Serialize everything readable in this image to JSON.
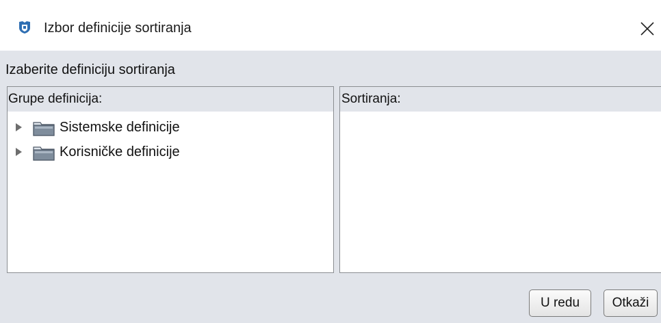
{
  "window": {
    "title": "Izbor definicije sortiranja",
    "app_icon": "app-shield-icon",
    "close_icon": "close-icon"
  },
  "instruction": "Izaberite definiciju sortiranja",
  "groups_panel": {
    "header": "Grupe definicija:",
    "items": [
      {
        "label": "Sistemske definicije",
        "icon": "folder-icon",
        "expanded": false
      },
      {
        "label": "Korisničke definicije",
        "icon": "folder-icon",
        "expanded": false
      }
    ]
  },
  "sortings_panel": {
    "header": "Sortiranja:",
    "items": []
  },
  "buttons": {
    "ok_label": "U redu",
    "cancel_label": "Otkaži"
  },
  "colors": {
    "dialog_background": "#e1e4ea",
    "panel_background": "#ffffff",
    "icon_accent": "#2f6fb3"
  }
}
